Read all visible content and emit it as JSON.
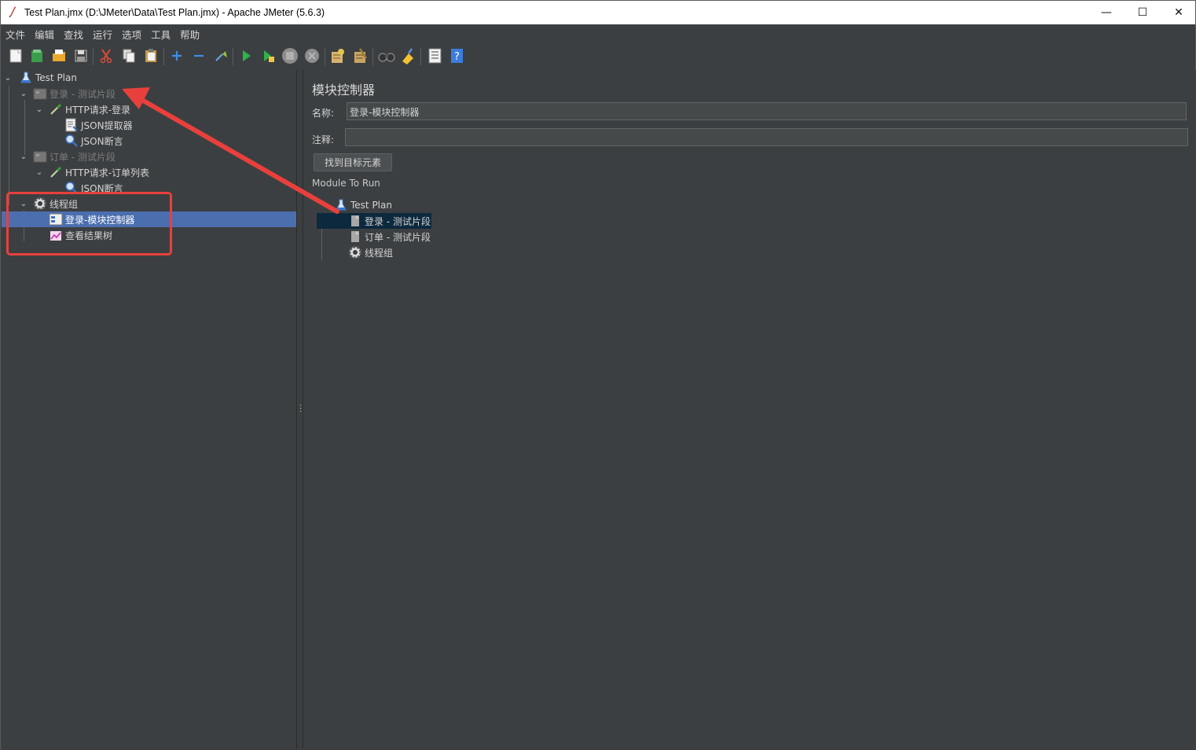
{
  "window": {
    "title": "Test Plan.jmx (D:\\JMeter\\Data\\Test Plan.jmx) - Apache JMeter (5.6.3)",
    "controls": {
      "minimize": "—",
      "maximize": "☐",
      "close": "✕"
    }
  },
  "menubar": [
    "文件",
    "编辑",
    "查找",
    "运行",
    "选项",
    "工具",
    "帮助"
  ],
  "toolbar": {
    "buttons": [
      "new-icon",
      "templates-icon",
      "open-icon",
      "save-icon",
      "cut-icon",
      "copy-icon",
      "paste-icon",
      "expand-icon",
      "collapse-icon",
      "toggle-icon",
      "start-icon",
      "start-no-pause-icon",
      "stop-icon",
      "shutdown-icon",
      "clear-icon",
      "clear-all-icon",
      "search-icon",
      "reset-search-icon",
      "function-helper-icon",
      "help-icon"
    ]
  },
  "tree": {
    "test_plan": "Test Plan",
    "login_fragment": "登录 - 测试片段",
    "http_login": "HTTP请求-登录",
    "json_extractor": "JSON提取器",
    "json_assert_1": "JSON断言",
    "order_fragment": "订单 - 测试片段",
    "http_orders": "HTTP请求-订单列表",
    "json_assert_2": "JSON断言",
    "thread_group": "线程组",
    "module_controller": "登录-模块控制器",
    "view_results_tree": "查看结果树"
  },
  "panel": {
    "title": "模块控制器",
    "name_label": "名称:",
    "name_value": "登录-模块控制器",
    "comment_label": "注释:",
    "comment_value": "",
    "find_button": "找到目标元素",
    "module_to_run_label": "Module To Run",
    "module_tree": {
      "root": "Test Plan",
      "items": [
        "登录 - 测试片段",
        "订单 - 测试片段",
        "线程组"
      ]
    }
  },
  "annotation_color": "#e8403c",
  "selection_color": "#4b6eaf"
}
